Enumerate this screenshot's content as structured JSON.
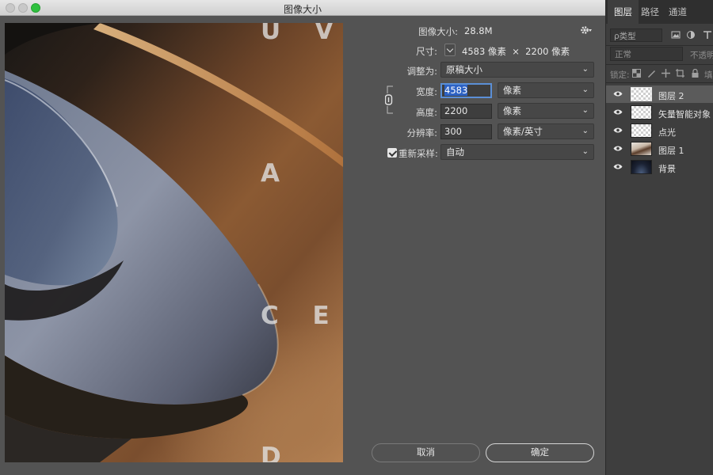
{
  "dialog": {
    "title": "图像大小",
    "image_size_label": "图像大小:",
    "image_size_value": "28.8M",
    "dimensions_label": "尺寸:",
    "dimensions_value": "4583 像素  ×  2200 像素",
    "fit_to_label": "调整为:",
    "fit_to_value": "原稿大小",
    "width_label": "宽度:",
    "width_value": "4583",
    "width_unit": "像素",
    "height_label": "高度:",
    "height_value": "2200",
    "height_unit": "像素",
    "resolution_label": "分辨率:",
    "resolution_value": "300",
    "resolution_unit": "像素/英寸",
    "resample_label": "重新采样:",
    "resample_checked": true,
    "resample_value": "自动",
    "cancel_label": "取消",
    "ok_label": "确定",
    "preview_letters": [
      "U V I",
      "A",
      "C E I",
      "D"
    ]
  },
  "layers_panel": {
    "tabs": [
      {
        "label": "图层",
        "active": true
      },
      {
        "label": "路径",
        "active": false
      },
      {
        "label": "通道",
        "active": false
      }
    ],
    "filter_placeholder": "ρ类型",
    "blend_mode": "正常",
    "opacity_label": "不透明",
    "lock_label": "锁定:",
    "fill_label": "填",
    "layers": [
      {
        "name": "图层 2",
        "thumb": "transparent",
        "selected": true
      },
      {
        "name": "矢量智能对象",
        "thumb": "transparent",
        "selected": false
      },
      {
        "name": "点光",
        "thumb": "transparent",
        "selected": false
      },
      {
        "name": "图层 1",
        "thumb": "photo",
        "selected": false
      },
      {
        "name": "背景",
        "thumb": "background",
        "selected": false
      }
    ]
  },
  "colors": {
    "dialog_bg": "#535353",
    "panel_bg": "#3e3e3e",
    "selection": "#2d62c4",
    "traffic_green": "#2fc13f"
  }
}
